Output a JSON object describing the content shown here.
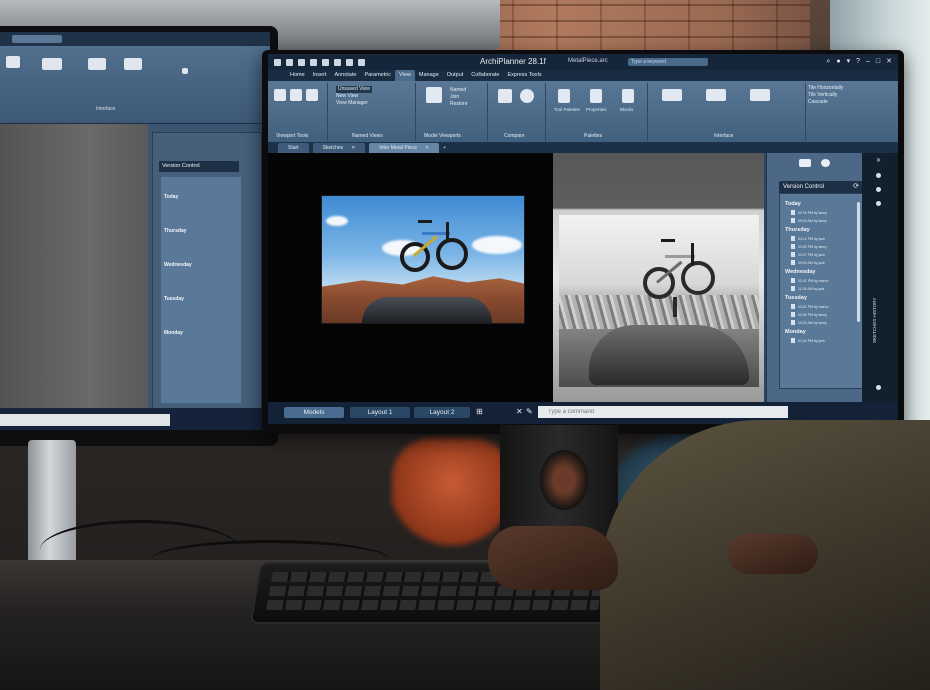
{
  "app": {
    "title": "ArchiPlanner 28.1f",
    "file_name": "MetalPiece.arc",
    "search_placeholder": "Type a keyword"
  },
  "menu": [
    "Home",
    "Insert",
    "Annotate",
    "Parametric",
    "View",
    "Manage",
    "Output",
    "Collaborate",
    "Express Tools"
  ],
  "ribbon": {
    "groups": [
      "Viewport Tools",
      "Named Views",
      "Model Viewports",
      "Compare",
      "Palettes",
      "Interface"
    ],
    "view_menu": [
      "Unsaved View",
      "New View",
      "View Manager"
    ],
    "model_viewports": [
      "Named",
      "Join",
      "Restore"
    ],
    "palettes": [
      "Tool Palettes",
      "Properties",
      "Blocks"
    ],
    "interface_items": [
      "Tile Horizontally",
      "Tile Vertically",
      "Cascade"
    ]
  },
  "doc_tabs": [
    "Start",
    "Sketches",
    "Inter Metal Piece"
  ],
  "version_control": {
    "title": "Version Control",
    "groups": [
      {
        "day": "Today",
        "entries": [
          "02:15 PM by lanny",
          "09:04 AM by lanny"
        ]
      },
      {
        "day": "Thursday",
        "entries": [
          "04:12 PM by jack",
          "03:00 PM by lanny",
          "02:27 PM by jack",
          "09:00 AM by jack"
        ]
      },
      {
        "day": "Wednesday",
        "entries": [
          "02:41 PM by marno",
          "11:24 AM by jack"
        ]
      },
      {
        "day": "Tuesday",
        "entries": [
          "03:22 PM by marno",
          "02:09 PM by lanny",
          "10:02 AM by lanny"
        ]
      },
      {
        "day": "Monday",
        "entries": [
          "01:04 PM by jack"
        ]
      }
    ],
    "side_label": "SKETCHES HISTORY"
  },
  "layouts": [
    "Models",
    "Layout 1",
    "Layout 2"
  ],
  "command_placeholder": "Type a command",
  "left_monitor": {
    "panel_title": "Version Control",
    "groups": [
      "Today",
      "Thursday",
      "Wednesday",
      "Tuesday",
      "Monday"
    ],
    "ribbon_group": "Interface"
  }
}
